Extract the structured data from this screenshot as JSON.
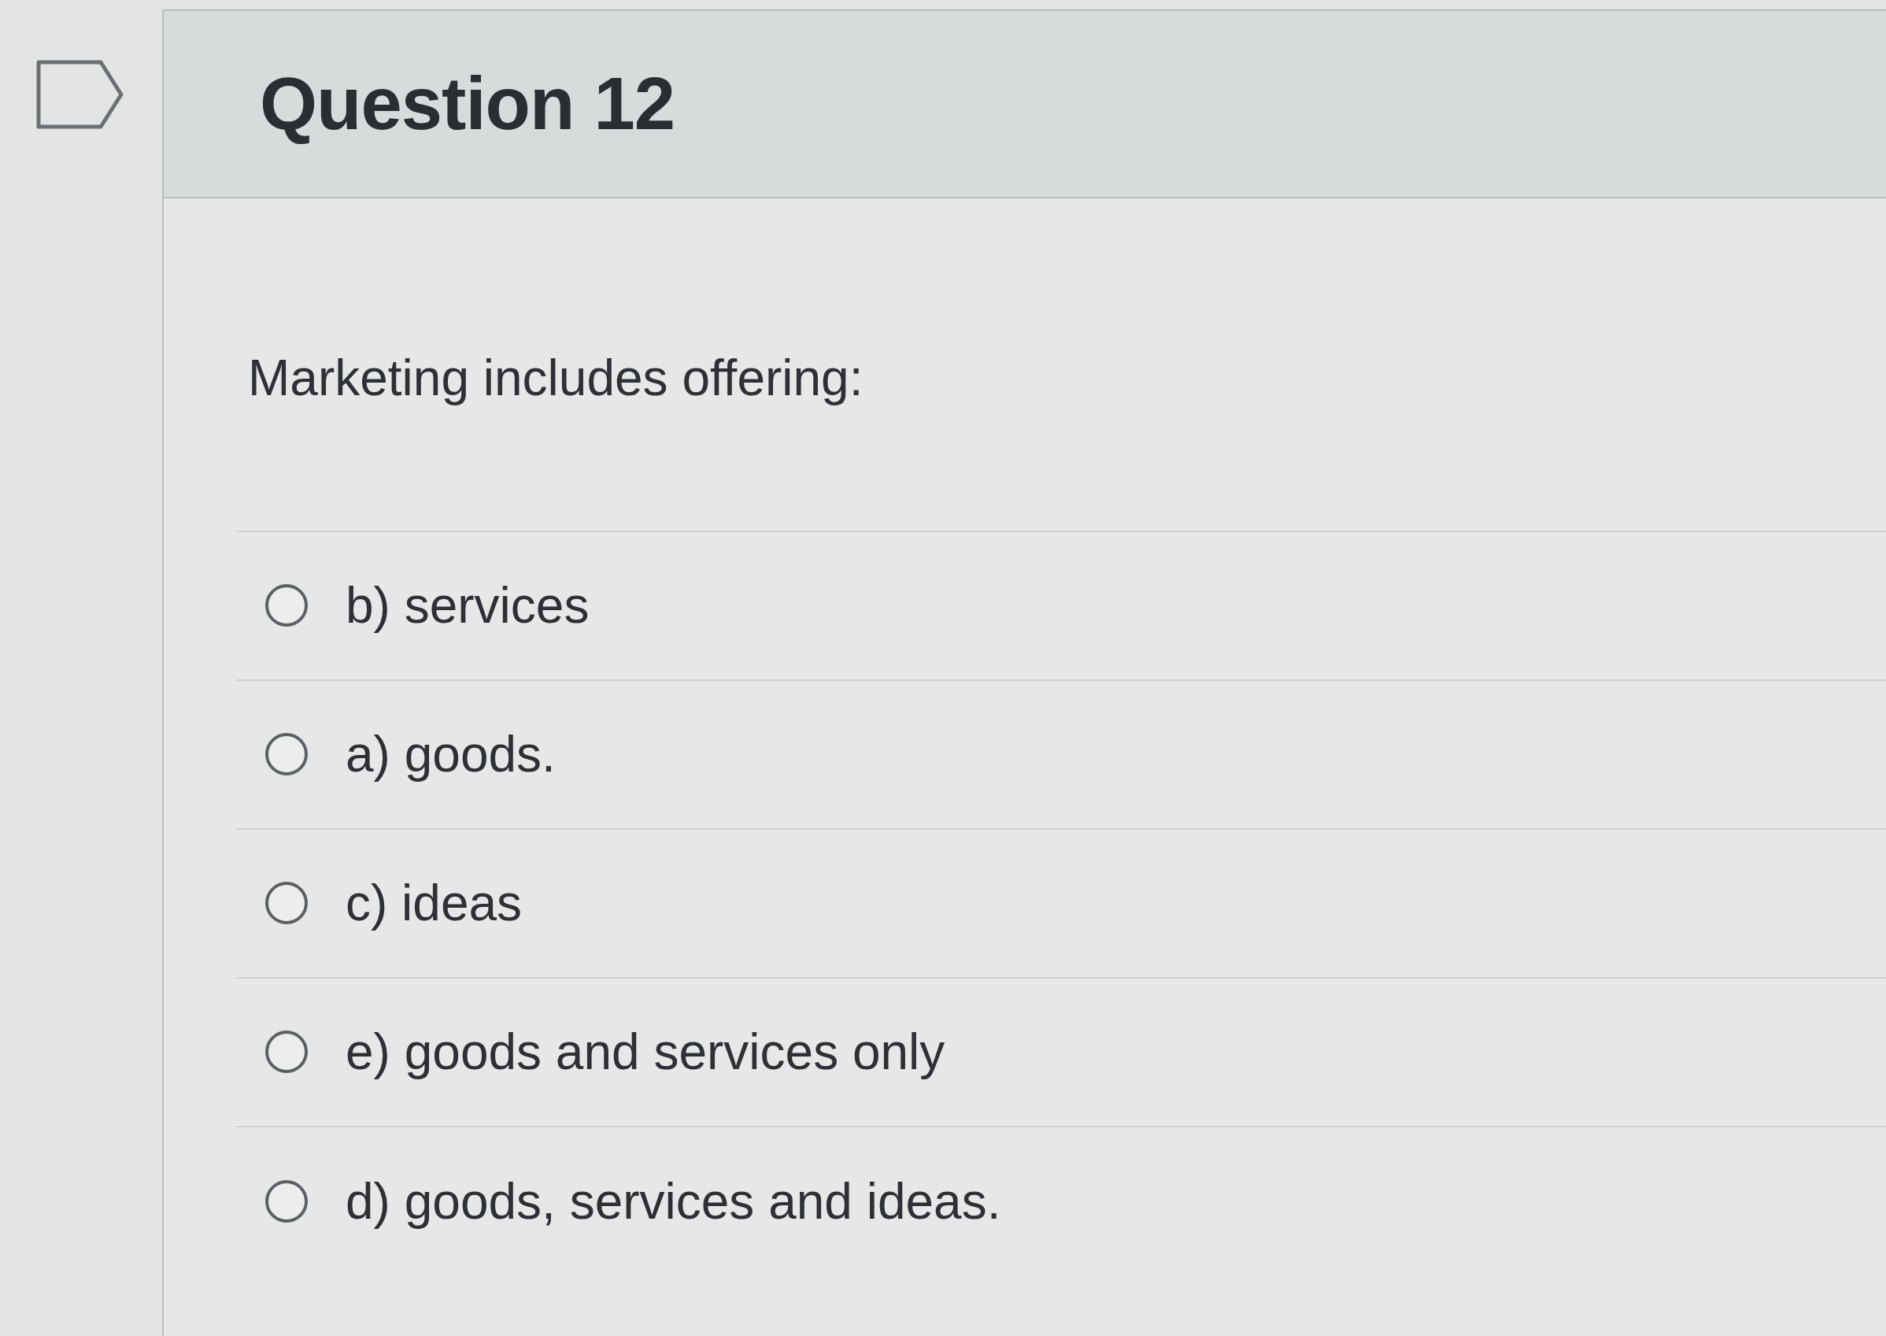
{
  "question": {
    "title": "Question 12",
    "prompt": "Marketing includes offering:",
    "options": [
      {
        "label": "b) services",
        "selected": false
      },
      {
        "label": "a) goods.",
        "selected": false
      },
      {
        "label": "c) ideas",
        "selected": false
      },
      {
        "label": "e) goods and services only",
        "selected": false
      },
      {
        "label": "d) goods, services and ideas.",
        "selected": false
      }
    ]
  }
}
